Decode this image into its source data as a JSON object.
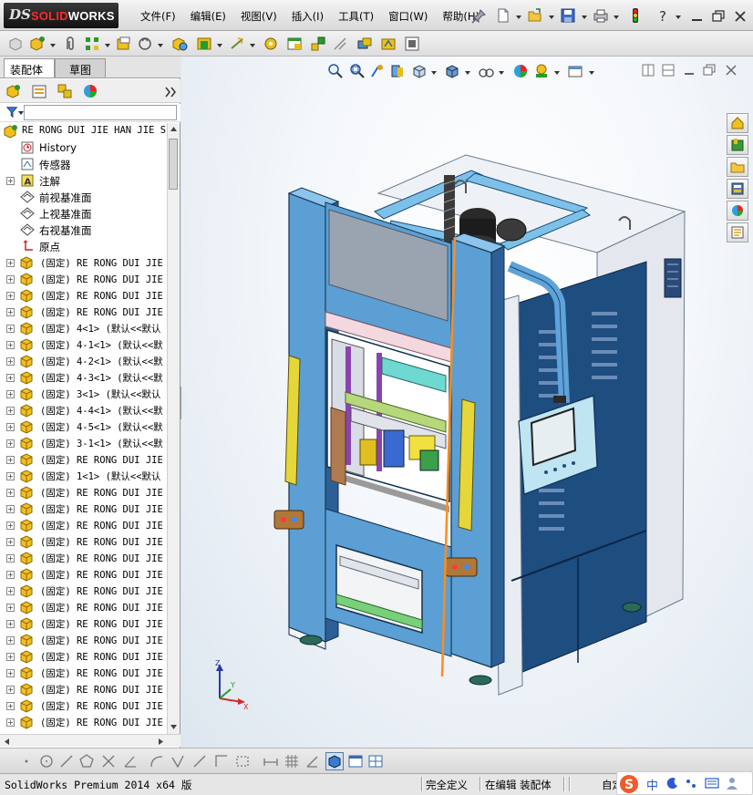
{
  "app": {
    "logo_ds": "DS",
    "logo_solid": "SOLID",
    "logo_works": "WORKS"
  },
  "menu": {
    "items": [
      "文件(F)",
      "编辑(E)",
      "视图(V)",
      "插入(I)",
      "工具(T)",
      "窗口(W)",
      "帮助(H)"
    ]
  },
  "panel": {
    "tabs": [
      "装配体",
      "草图"
    ]
  },
  "tree": {
    "root": "RE RONG DUI JIE HAN JIE S",
    "fixed_nodes": [
      {
        "icon": "history-icon",
        "label": "History",
        "expandable": false
      },
      {
        "icon": "sensor-icon",
        "label": "传感器",
        "expandable": false
      },
      {
        "icon": "annotation-icon",
        "label": "注解",
        "expandable": true
      },
      {
        "icon": "plane-icon",
        "label": "前视基准面",
        "expandable": false
      },
      {
        "icon": "plane-icon",
        "label": "上视基准面",
        "expandable": false
      },
      {
        "icon": "plane-icon",
        "label": "右视基准面",
        "expandable": false
      },
      {
        "icon": "origin-icon",
        "label": "原点",
        "expandable": false
      }
    ],
    "components": [
      "(固定) RE RONG DUI  JIE",
      "(固定) RE RONG DUI  JIE",
      "(固定) RE RONG DUI  JIE",
      "(固定) RE RONG DUI  JIE",
      "(固定) 4<1> (默认<<默认",
      "(固定) 4-1<1> (默认<<默",
      "(固定) 4-2<1> (默认<<默",
      "(固定) 4-3<1> (默认<<默",
      "(固定) 3<1> (默认<<默认",
      "(固定) 4-4<1> (默认<<默",
      "(固定) 4-5<1> (默认<<默",
      "(固定) 3-1<1> (默认<<默",
      "(固定) RE RONG DUI  JIE",
      "(固定) 1<1> (默认<<默认",
      "(固定) RE RONG DUI  JIE",
      "(固定) RE RONG DUI  JIE",
      "(固定) RE RONG DUI  JIE",
      "(固定) RE RONG DUI  JIE",
      "(固定) RE RONG DUI  JIE",
      "(固定) RE RONG DUI  JIE",
      "(固定) RE RONG DUI  JIE",
      "(固定) RE RONG DUI  JIE",
      "(固定) RE RONG DUI  JIE",
      "(固定) RE RONG DUI  JIE",
      "(固定) RE RONG DUI  JIE",
      "(固定) RE RONG DUI  JIE",
      "(固定) RE RONG DUI  JIE",
      "(固定) RE RONG DUI  JIE",
      "(固定) RE RONG DUI  JIE"
    ]
  },
  "triad": {
    "x_label": "X",
    "y_label": "Y",
    "z_label": "Z"
  },
  "status": {
    "product": "SolidWorks Premium 2014 x64 版",
    "defined": "完全定义",
    "editing": "在编辑 装配体",
    "custom": "自定义"
  },
  "ime": {
    "lang": "中"
  },
  "colors": {
    "machine_blue": "#5b9fd4",
    "machine_dark": "#163a66",
    "accent_orange": "#ff8c1a",
    "rail_yellow": "#e5d63a"
  }
}
